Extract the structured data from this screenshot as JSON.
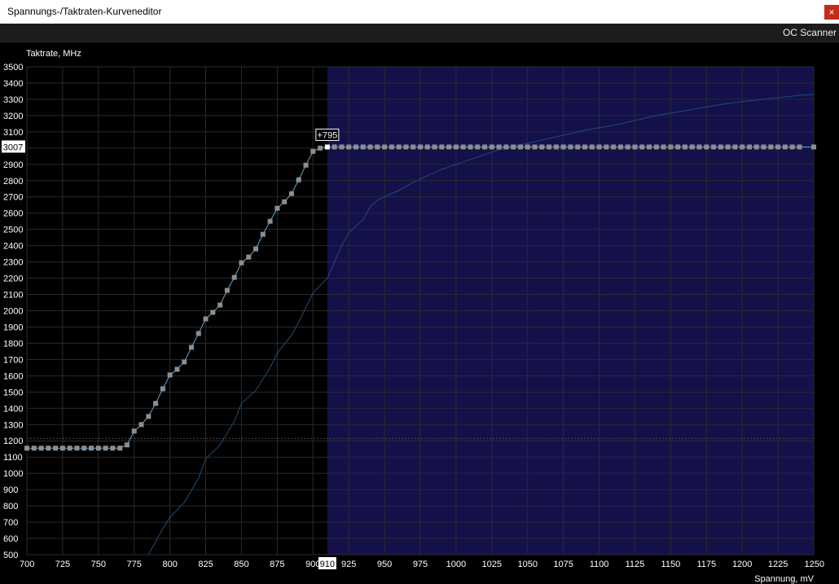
{
  "window": {
    "title": "Spannungs-/Taktraten-Kurveneditor",
    "close_label": "×"
  },
  "toolbar": {
    "oc_scanner_label": "OC Scanner"
  },
  "colors": {
    "background": "#000000",
    "locked_region": "#14104a",
    "grid": "#2b2b2b",
    "curve": "#5aa8e0",
    "point": "#8e8e8e",
    "selected_point": "#ffffff",
    "reference_curve": "#1e4e7a"
  },
  "chart_data": {
    "type": "line",
    "title": "",
    "ylabel": "Taktrate, MHz",
    "xlabel": "Spannung, mV",
    "xlim": [
      700,
      1250
    ],
    "ylim": [
      500,
      3500
    ],
    "x_ticks": [
      700,
      725,
      750,
      775,
      800,
      825,
      850,
      875,
      900,
      925,
      950,
      975,
      1000,
      1025,
      1050,
      1075,
      1100,
      1125,
      1150,
      1175,
      1200,
      1225,
      1250
    ],
    "y_ticks": [
      500,
      600,
      700,
      800,
      900,
      1000,
      1100,
      1200,
      1300,
      1400,
      1500,
      1600,
      1700,
      1800,
      1900,
      2000,
      2100,
      2200,
      2300,
      2400,
      2500,
      2600,
      2700,
      2800,
      2900,
      3000,
      3100,
      3200,
      3300,
      3400,
      3500
    ],
    "grid": true,
    "locked_from_x": 910,
    "selected_point": {
      "x": 910,
      "y": 3007,
      "offset_label": "+795",
      "x_label": "910",
      "y_label": "3007"
    },
    "reference_line_y": 1215,
    "series": [
      {
        "points": [
          [
            700,
            1155
          ],
          [
            705,
            1155
          ],
          [
            710,
            1155
          ],
          [
            715,
            1155
          ],
          [
            720,
            1155
          ],
          [
            725,
            1155
          ],
          [
            730,
            1155
          ],
          [
            735,
            1155
          ],
          [
            740,
            1155
          ],
          [
            745,
            1155
          ],
          [
            750,
            1155
          ],
          [
            755,
            1155
          ],
          [
            760,
            1155
          ],
          [
            765,
            1155
          ],
          [
            770,
            1175
          ],
          [
            775,
            1260
          ],
          [
            780,
            1300
          ],
          [
            785,
            1350
          ],
          [
            790,
            1430
          ],
          [
            795,
            1520
          ],
          [
            800,
            1605
          ],
          [
            805,
            1640
          ],
          [
            810,
            1685
          ],
          [
            815,
            1775
          ],
          [
            820,
            1860
          ],
          [
            825,
            1950
          ],
          [
            830,
            1990
          ],
          [
            835,
            2035
          ],
          [
            840,
            2125
          ],
          [
            845,
            2205
          ],
          [
            850,
            2295
          ],
          [
            855,
            2330
          ],
          [
            860,
            2380
          ],
          [
            865,
            2470
          ],
          [
            870,
            2550
          ],
          [
            875,
            2630
          ],
          [
            880,
            2670
          ],
          [
            885,
            2720
          ],
          [
            890,
            2805
          ],
          [
            895,
            2895
          ],
          [
            900,
            2980
          ],
          [
            905,
            3000
          ],
          [
            910,
            3007
          ],
          [
            915,
            3007
          ],
          [
            920,
            3007
          ],
          [
            925,
            3007
          ],
          [
            930,
            3007
          ],
          [
            935,
            3007
          ],
          [
            940,
            3007
          ],
          [
            945,
            3007
          ],
          [
            950,
            3007
          ],
          [
            955,
            3007
          ],
          [
            960,
            3007
          ],
          [
            965,
            3007
          ],
          [
            970,
            3007
          ],
          [
            975,
            3007
          ],
          [
            980,
            3007
          ],
          [
            985,
            3007
          ],
          [
            990,
            3007
          ],
          [
            995,
            3007
          ],
          [
            1000,
            3007
          ],
          [
            1005,
            3007
          ],
          [
            1010,
            3007
          ],
          [
            1015,
            3007
          ],
          [
            1020,
            3007
          ],
          [
            1025,
            3007
          ],
          [
            1030,
            3007
          ],
          [
            1035,
            3007
          ],
          [
            1040,
            3007
          ],
          [
            1045,
            3007
          ],
          [
            1050,
            3007
          ],
          [
            1055,
            3007
          ],
          [
            1060,
            3007
          ],
          [
            1065,
            3007
          ],
          [
            1070,
            3007
          ],
          [
            1075,
            3007
          ],
          [
            1080,
            3007
          ],
          [
            1085,
            3007
          ],
          [
            1090,
            3007
          ],
          [
            1095,
            3007
          ],
          [
            1100,
            3007
          ],
          [
            1105,
            3007
          ],
          [
            1110,
            3007
          ],
          [
            1115,
            3007
          ],
          [
            1120,
            3007
          ],
          [
            1125,
            3007
          ],
          [
            1130,
            3007
          ],
          [
            1135,
            3007
          ],
          [
            1140,
            3007
          ],
          [
            1145,
            3007
          ],
          [
            1150,
            3007
          ],
          [
            1155,
            3007
          ],
          [
            1160,
            3007
          ],
          [
            1165,
            3007
          ],
          [
            1170,
            3007
          ],
          [
            1175,
            3007
          ],
          [
            1180,
            3007
          ],
          [
            1185,
            3007
          ],
          [
            1190,
            3007
          ],
          [
            1195,
            3007
          ],
          [
            1200,
            3007
          ],
          [
            1205,
            3007
          ],
          [
            1210,
            3007
          ],
          [
            1215,
            3007
          ],
          [
            1220,
            3007
          ],
          [
            1225,
            3007
          ],
          [
            1230,
            3007
          ],
          [
            1235,
            3007
          ],
          [
            1240,
            3007
          ],
          [
            1250,
            3007
          ]
        ]
      },
      {
        "points": [
          [
            785,
            500
          ],
          [
            790,
            580
          ],
          [
            795,
            660
          ],
          [
            800,
            730
          ],
          [
            810,
            820
          ],
          [
            820,
            970
          ],
          [
            825,
            1090
          ],
          [
            835,
            1175
          ],
          [
            845,
            1320
          ],
          [
            850,
            1430
          ],
          [
            860,
            1510
          ],
          [
            870,
            1650
          ],
          [
            875,
            1740
          ],
          [
            885,
            1850
          ],
          [
            890,
            1930
          ],
          [
            900,
            2110
          ],
          [
            910,
            2200
          ],
          [
            915,
            2300
          ],
          [
            920,
            2400
          ],
          [
            925,
            2480
          ],
          [
            935,
            2560
          ],
          [
            940,
            2640
          ],
          [
            945,
            2680
          ],
          [
            960,
            2740
          ],
          [
            970,
            2790
          ],
          [
            980,
            2830
          ],
          [
            990,
            2870
          ],
          [
            1000,
            2900
          ],
          [
            1010,
            2930
          ],
          [
            1020,
            2960
          ],
          [
            1030,
            2990
          ],
          [
            1040,
            3010
          ],
          [
            1050,
            3030
          ],
          [
            1060,
            3050
          ],
          [
            1070,
            3070
          ],
          [
            1080,
            3090
          ],
          [
            1090,
            3110
          ],
          [
            1100,
            3125
          ],
          [
            1110,
            3140
          ],
          [
            1120,
            3160
          ],
          [
            1130,
            3180
          ],
          [
            1140,
            3200
          ],
          [
            1150,
            3215
          ],
          [
            1160,
            3230
          ],
          [
            1170,
            3245
          ],
          [
            1180,
            3260
          ],
          [
            1190,
            3275
          ],
          [
            1200,
            3285
          ],
          [
            1210,
            3295
          ],
          [
            1220,
            3305
          ],
          [
            1230,
            3315
          ],
          [
            1240,
            3325
          ],
          [
            1250,
            3330
          ]
        ]
      }
    ]
  }
}
